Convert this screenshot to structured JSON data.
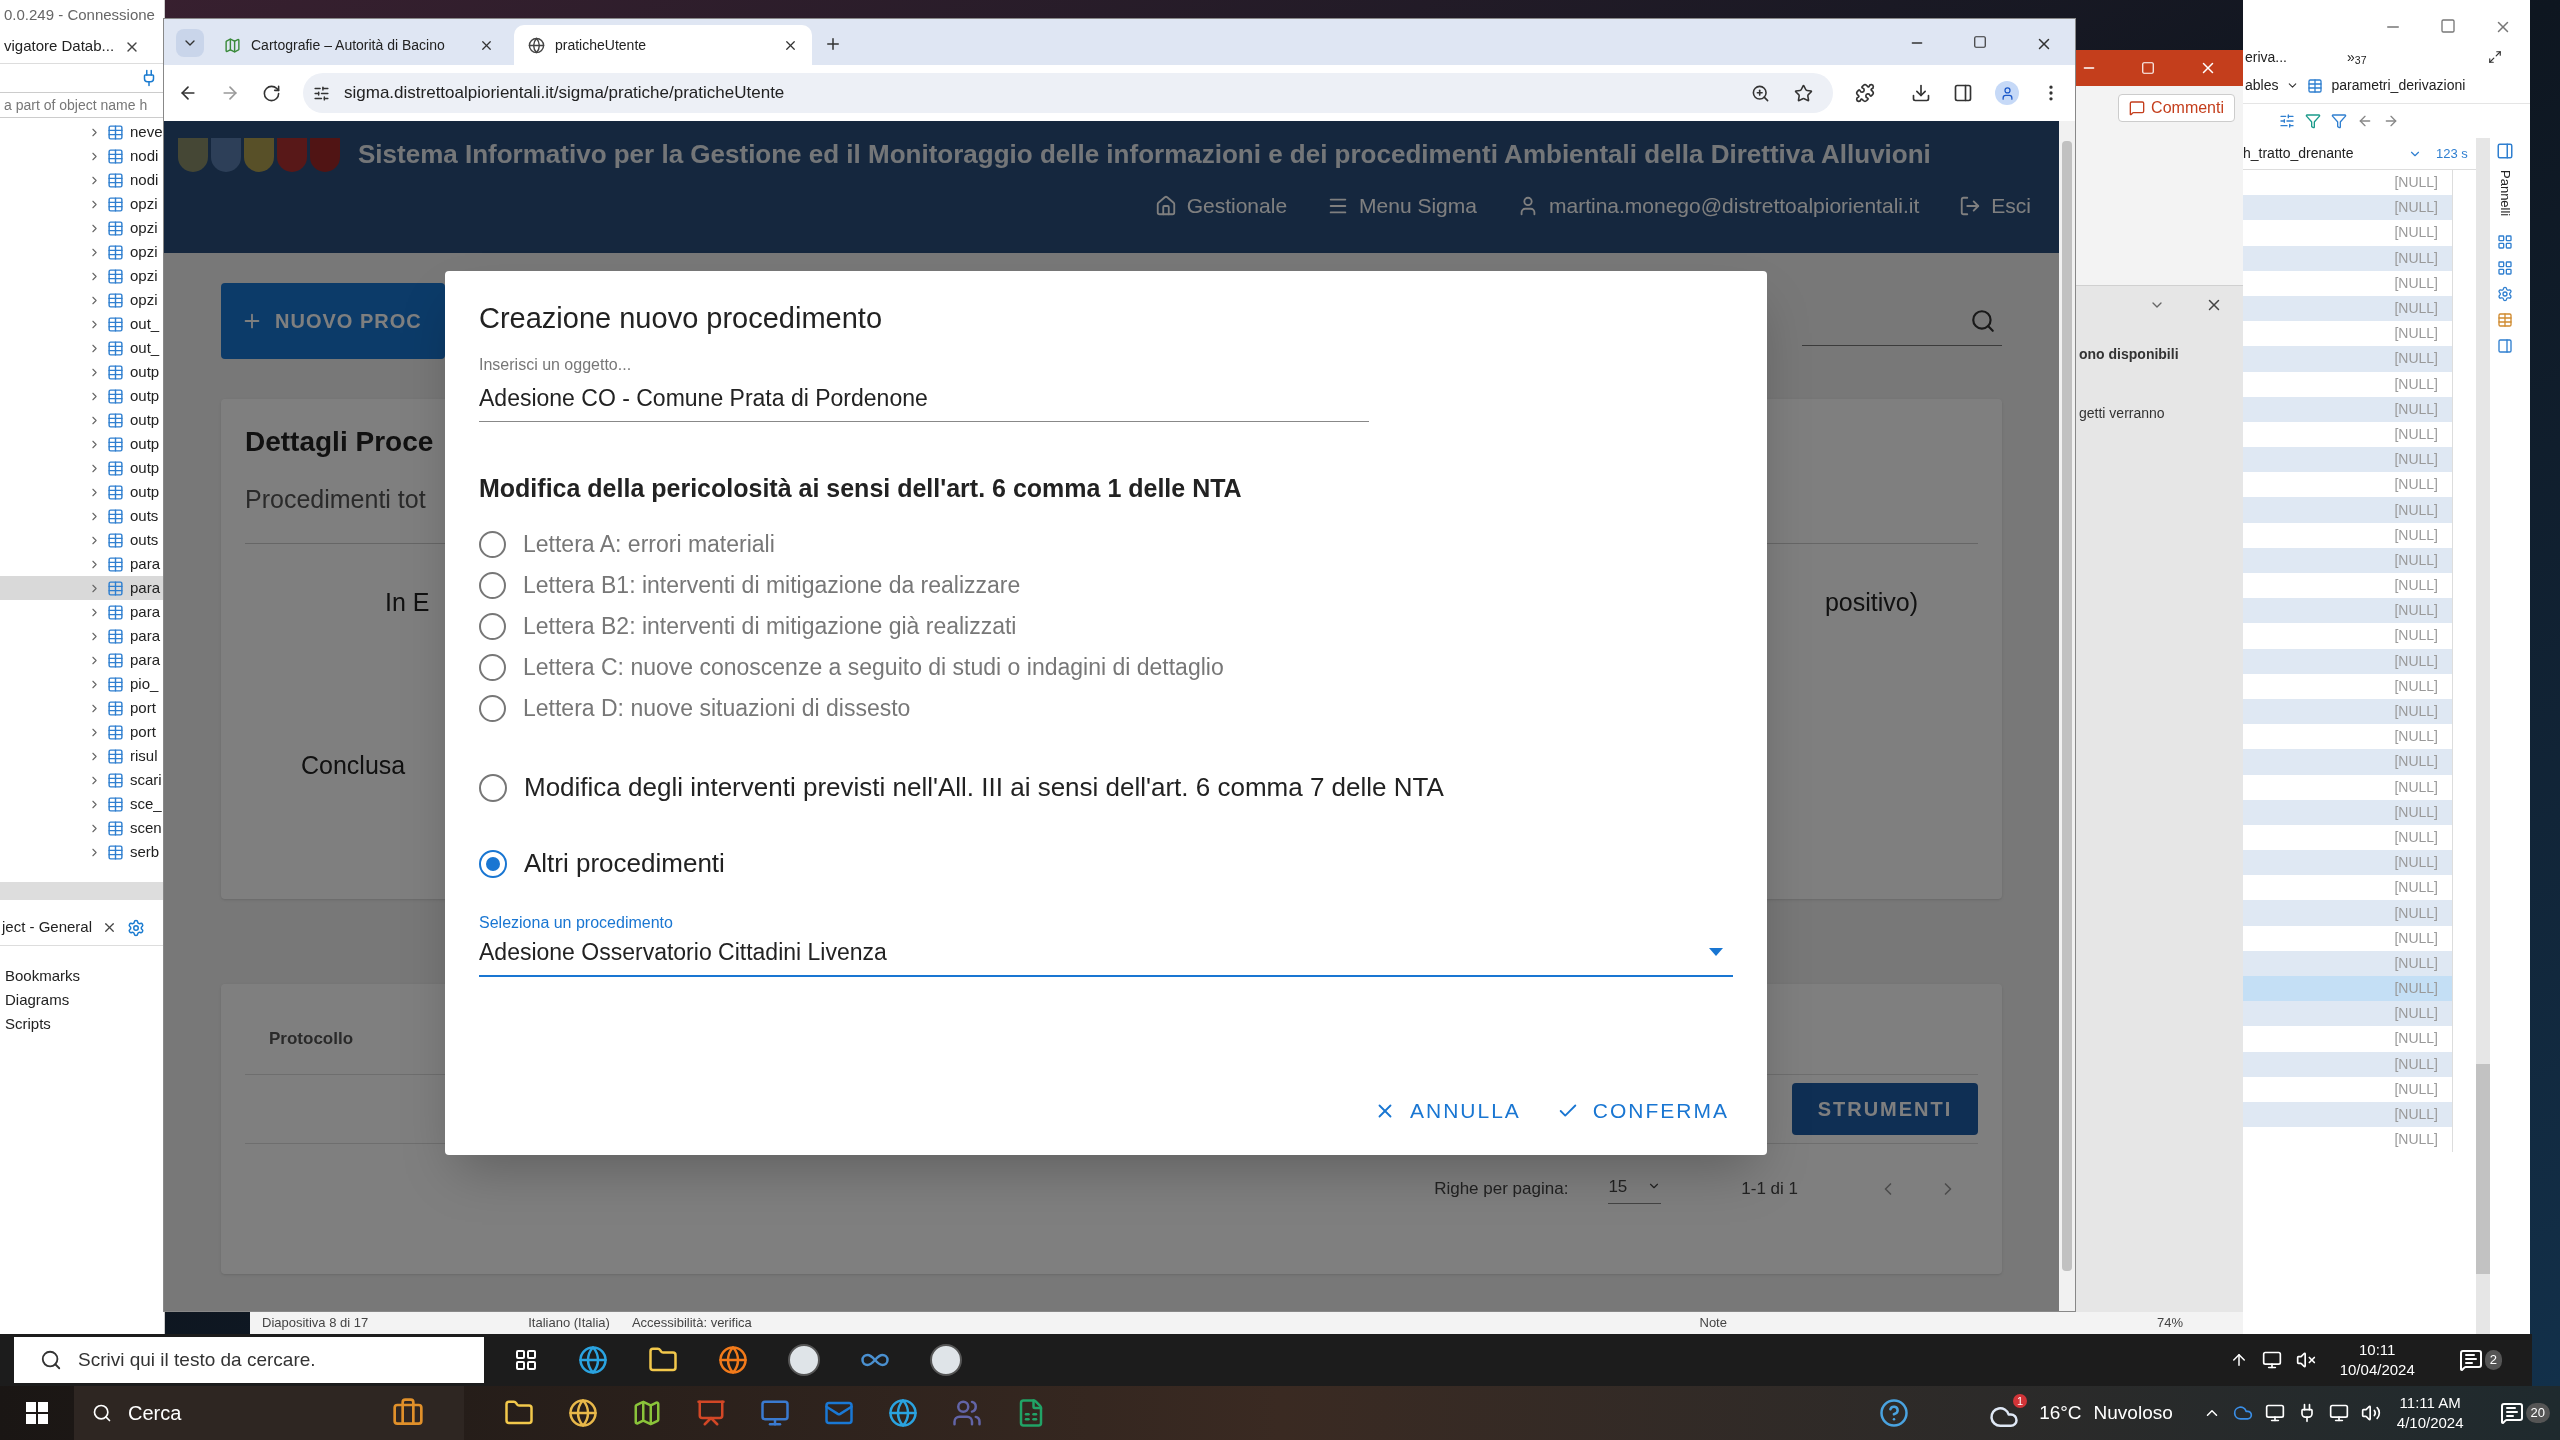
{
  "dbeaver_left": {
    "title": "0.0.249 - Connessione",
    "tab": "vigatore Datab...",
    "filter_placeholder": "a part of object name h",
    "tree": [
      {
        "label": "neve",
        "selected": false
      },
      {
        "label": "nodi",
        "selected": false
      },
      {
        "label": "nodi",
        "selected": false
      },
      {
        "label": "opzi",
        "selected": false
      },
      {
        "label": "opzi",
        "selected": false
      },
      {
        "label": "opzi",
        "selected": false
      },
      {
        "label": "opzi",
        "selected": false
      },
      {
        "label": "opzi",
        "selected": false
      },
      {
        "label": "out_",
        "selected": false
      },
      {
        "label": "out_",
        "selected": false
      },
      {
        "label": "outp",
        "selected": false
      },
      {
        "label": "outp",
        "selected": false
      },
      {
        "label": "outp",
        "selected": false
      },
      {
        "label": "outp",
        "selected": false
      },
      {
        "label": "outp",
        "selected": false
      },
      {
        "label": "outp",
        "selected": false
      },
      {
        "label": "outs",
        "selected": false
      },
      {
        "label": "outs",
        "selected": false
      },
      {
        "label": "para",
        "selected": false
      },
      {
        "label": "para",
        "selected": true
      },
      {
        "label": "para",
        "selected": false
      },
      {
        "label": "para",
        "selected": false
      },
      {
        "label": "para",
        "selected": false
      },
      {
        "label": "pio_",
        "selected": false
      },
      {
        "label": "port",
        "selected": false
      },
      {
        "label": "port",
        "selected": false
      },
      {
        "label": "risul",
        "selected": false
      },
      {
        "label": "scari",
        "selected": false
      },
      {
        "label": "sce_",
        "selected": false
      },
      {
        "label": "scen",
        "selected": false
      },
      {
        "label": "serb",
        "selected": false
      }
    ],
    "bottom_tab": "ject - General",
    "links": [
      "Bookmarks",
      "Diagrams",
      "Scripts"
    ]
  },
  "browser": {
    "tabs": [
      {
        "title": "Cartografie – Autorità di Bacino",
        "selected": false
      },
      {
        "title": "praticheUtente",
        "selected": true
      }
    ],
    "url": "sigma.distrettoalpiorientali.it/sigma/pratiche/praticheUtente"
  },
  "site": {
    "title": "Sistema Informativo per la Gestione ed il Monitoraggio delle informazioni e dei procedimenti Ambientali della Direttiva Alluvioni",
    "nav": [
      {
        "kind": "home",
        "label": "Gestionale"
      },
      {
        "kind": "menu",
        "label": "Menu Sigma"
      },
      {
        "kind": "user",
        "label": "martina.monego@distrettoalpiorientali.it"
      },
      {
        "kind": "logout",
        "label": "Esci"
      }
    ]
  },
  "page": {
    "new_button": "NUOVO PROC",
    "details": {
      "title": "Dettagli Proce",
      "subtitle": "Procedimenti tot",
      "status_left": "In E",
      "status_right": "positivo)",
      "status_bottom": "Conclusa"
    },
    "table": {
      "columns": [
        "Protocollo"
      ],
      "tools_button": "STRUMENTI",
      "rows_per_page_label": "Righe per pagina:",
      "rows_per_page": "15",
      "range": "1-1 di 1"
    }
  },
  "dialog": {
    "title": "Creazione nuovo procedimento",
    "subject": {
      "label": "Inserisci un oggetto...",
      "value": "Adesione CO - Comune Prata di Pordenone"
    },
    "section_heading": "Modifica della pericolosità ai sensi dell'art. 6 comma 1 delle NTA",
    "options": [
      {
        "kind": "sub",
        "label": "Lettera A: errori materiali",
        "selected": false
      },
      {
        "kind": "sub",
        "label": "Lettera B1: interventi di mitigazione da realizzare",
        "selected": false
      },
      {
        "kind": "sub",
        "label": "Lettera B2: interventi di mitigazione già realizzati",
        "selected": false
      },
      {
        "kind": "sub",
        "label": "Lettera C: nuove conoscenze a seguito di studi o indagini di dettaglio",
        "selected": false
      },
      {
        "kind": "sub",
        "label": "Lettera D: nuove situazioni di dissesto",
        "selected": false
      },
      {
        "kind": "main",
        "label": "Modifica degli interventi previsti nell'All. III ai sensi dell'art. 6 comma 7 delle NTA",
        "selected": false
      },
      {
        "kind": "main",
        "label": "Altri procedimenti",
        "selected": true
      }
    ],
    "select": {
      "label": "Seleziona un procedimento",
      "value": "Adesione Osservatorio Cittadini Livenza"
    },
    "buttons": [
      {
        "kind": "cancel",
        "label": "ANNULLA"
      },
      {
        "kind": "confirm",
        "label": "CONFERMA"
      }
    ]
  },
  "powerpoint": {
    "comments_button": "Commenti",
    "pane_texts": [
      "ono disponibili",
      "getti verranno"
    ],
    "status": {
      "slide": "Diapositiva 8 di 17",
      "language": "Italiano (Italia)",
      "accessibility": "Accessibilità: verifica",
      "notes": "Note",
      "zoom": "74%"
    }
  },
  "dbeaver_right": {
    "tab": "eriva...",
    "overflow": "»$_{37}$",
    "breadcrumb": [
      "ables",
      "parametri_derivazioni"
    ],
    "column": "h_tratto_drenante",
    "column_2": "123 s",
    "side_panel": "Pannelli",
    "rows": [
      {
        "value": "[NULL]",
        "selected": false
      },
      {
        "value": "[NULL]",
        "selected": false
      },
      {
        "value": "[NULL]",
        "selected": false
      },
      {
        "value": "[NULL]",
        "selected": false
      },
      {
        "value": "[NULL]",
        "selected": false
      },
      {
        "value": "[NULL]",
        "selected": false
      },
      {
        "value": "[NULL]",
        "selected": false
      },
      {
        "value": "[NULL]",
        "selected": false
      },
      {
        "value": "[NULL]",
        "selected": false
      },
      {
        "value": "[NULL]",
        "selected": false
      },
      {
        "value": "[NULL]",
        "selected": false
      },
      {
        "value": "[NULL]",
        "selected": false
      },
      {
        "value": "[NULL]",
        "selected": false
      },
      {
        "value": "[NULL]",
        "selected": false
      },
      {
        "value": "[NULL]",
        "selected": false
      },
      {
        "value": "[NULL]",
        "selected": false
      },
      {
        "value": "[NULL]",
        "selected": false
      },
      {
        "value": "[NULL]",
        "selected": false
      },
      {
        "value": "[NULL]",
        "selected": false
      },
      {
        "value": "[NULL]",
        "selected": false
      },
      {
        "value": "[NULL]",
        "selected": false
      },
      {
        "value": "[NULL]",
        "selected": false
      },
      {
        "value": "[NULL]",
        "selected": false
      },
      {
        "value": "[NULL]",
        "selected": false
      },
      {
        "value": "[NULL]",
        "selected": false
      },
      {
        "value": "[NULL]",
        "selected": false
      },
      {
        "value": "[NULL]",
        "selected": false
      },
      {
        "value": "[NULL]",
        "selected": false
      },
      {
        "value": "[NULL]",
        "selected": false
      },
      {
        "value": "[NULL]",
        "selected": false
      },
      {
        "value": "[NULL]",
        "selected": false
      },
      {
        "value": "[NULL]",
        "selected": false
      },
      {
        "value": "[NULL]",
        "selected": true
      },
      {
        "value": "[NULL]",
        "selected": false
      },
      {
        "value": "[NULL]",
        "selected": false
      },
      {
        "value": "[NULL]",
        "selected": false
      },
      {
        "value": "[NULL]",
        "selected": false
      },
      {
        "value": "[NULL]",
        "selected": false
      },
      {
        "value": "[NULL]",
        "selected": false
      }
    ]
  },
  "remote_taskbar": {
    "search_placeholder": "Scrivi qui il testo da cercare.",
    "time": "10:11",
    "date": "10/04/2024",
    "notifications": "2"
  },
  "taskbar": {
    "search": "Cerca",
    "weather_badge": "1",
    "temperature": "16°C",
    "condition": "Nuvoloso",
    "time": "11:11 AM",
    "date": "4/10/2024",
    "notifications": "20"
  }
}
